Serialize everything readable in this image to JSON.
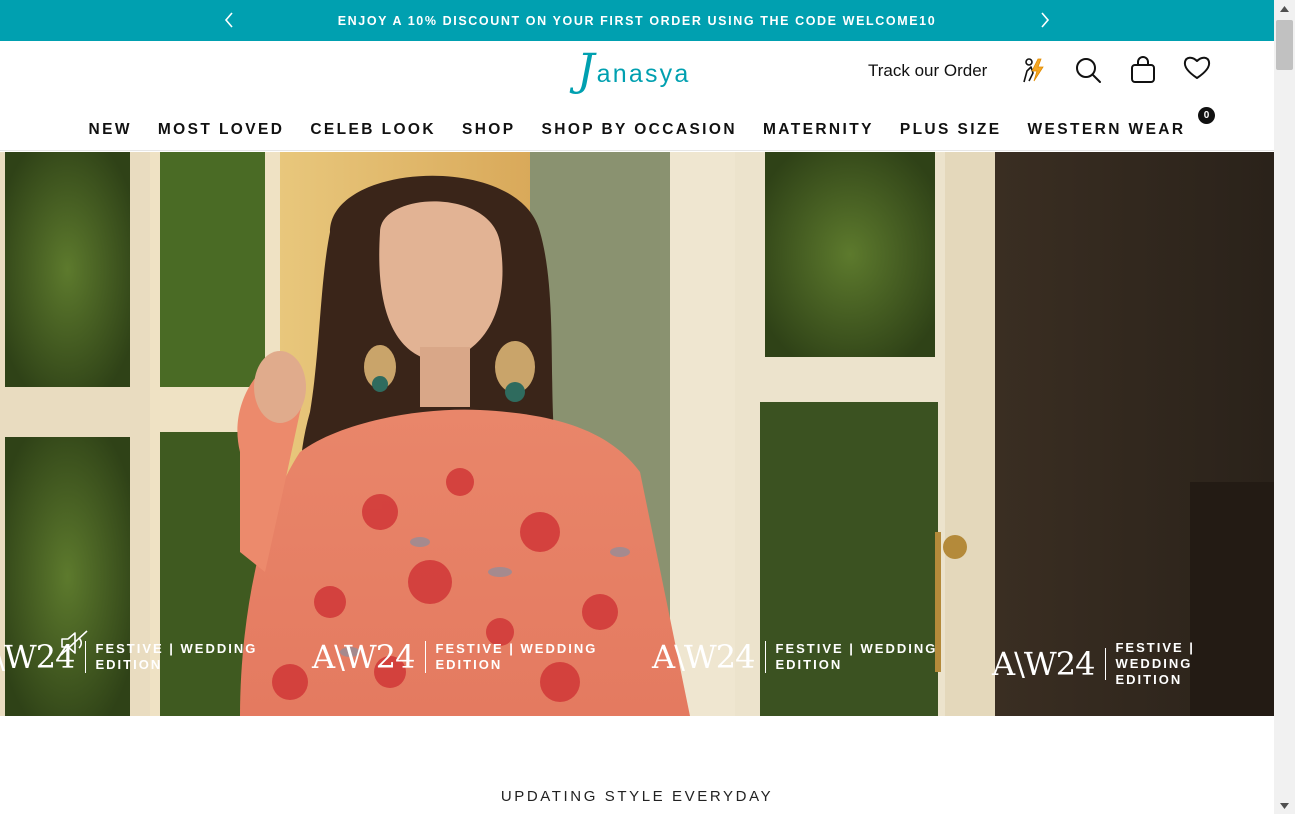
{
  "announcement": {
    "text": "ENJOY A 10% DISCOUNT ON YOUR FIRST ORDER USING THE CODE WELCOME10",
    "prev_icon": "chevron-left-icon",
    "next_icon": "chevron-right-icon"
  },
  "header": {
    "logo_initial": "J",
    "logo_rest": "anasya",
    "track_order": "Track our Order",
    "icons": [
      "fast-delivery-icon",
      "search-icon",
      "shopping-bag-icon",
      "wishlist-heart-icon"
    ],
    "wishlist_count": "0"
  },
  "nav": {
    "items": [
      "NEW",
      "MOST LOVED",
      "CELEB LOOK",
      "SHOP",
      "SHOP BY OCCASION",
      "MATERNITY",
      "PLUS SIZE",
      "WESTERN WEAR"
    ]
  },
  "hero": {
    "banner_mark": "A\\W24",
    "banner_line1": "FESTIVE | WEDDING",
    "banner_line2": "EDITION",
    "mute_icon": "speaker-muted-icon"
  },
  "section": {
    "tagline": "UPDATING STYLE EVERYDAY"
  },
  "colors": {
    "brand_teal": "#00a0b0",
    "text_dark": "#111111",
    "announcement_text": "#ffffff"
  }
}
